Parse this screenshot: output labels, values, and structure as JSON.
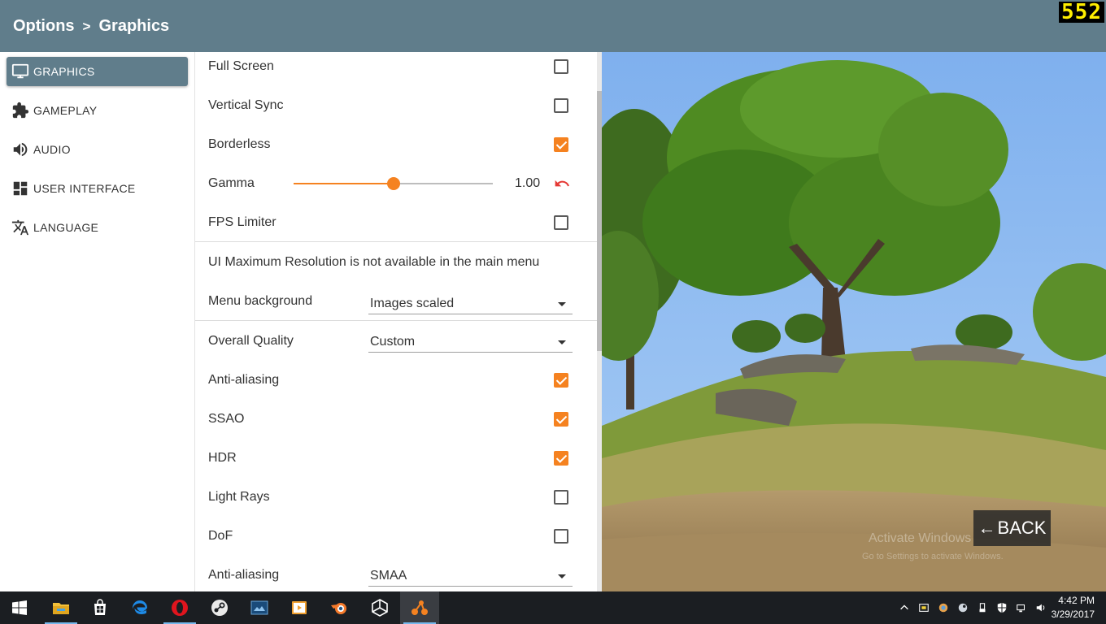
{
  "header": {
    "breadcrumb_root": "Options",
    "breadcrumb_sep": ">",
    "breadcrumb_current": "Graphics",
    "fps_counter": "552"
  },
  "sidebar": {
    "items": [
      {
        "label": "GRAPHICS",
        "icon": "monitor-icon",
        "active": true
      },
      {
        "label": "GAMEPLAY",
        "icon": "puzzle-icon",
        "active": false
      },
      {
        "label": "AUDIO",
        "icon": "speaker-icon",
        "active": false
      },
      {
        "label": "USER INTERFACE",
        "icon": "dashboard-icon",
        "active": false
      },
      {
        "label": "LANGUAGE",
        "icon": "translate-icon",
        "active": false
      }
    ]
  },
  "options": {
    "full_screen": {
      "label": "Full Screen",
      "checked": false
    },
    "vertical_sync": {
      "label": "Vertical Sync",
      "checked": false
    },
    "borderless": {
      "label": "Borderless",
      "checked": true
    },
    "gamma": {
      "label": "Gamma",
      "value": "1.00",
      "fraction": 0.5
    },
    "fps_limiter": {
      "label": "FPS Limiter",
      "checked": false
    },
    "ui_max_res_note": "UI Maximum Resolution is not available in the main menu",
    "menu_background": {
      "label": "Menu background",
      "value": "Images scaled"
    },
    "overall_quality": {
      "label": "Overall Quality",
      "value": "Custom"
    },
    "anti_aliasing_toggle": {
      "label": "Anti-aliasing",
      "checked": true
    },
    "ssao": {
      "label": "SSAO",
      "checked": true
    },
    "hdr": {
      "label": "HDR",
      "checked": true
    },
    "light_rays": {
      "label": "Light Rays",
      "checked": false
    },
    "dof": {
      "label": "DoF",
      "checked": false
    },
    "anti_aliasing_mode": {
      "label": "Anti-aliasing",
      "value": "SMAA"
    }
  },
  "gameview": {
    "back_label": "BACK",
    "back_arrow": "←",
    "watermark_line1": "Activate Windows",
    "watermark_line2": "Go to Settings to activate Windows."
  },
  "taskbar": {
    "apps": [
      "windows-start-icon",
      "file-explorer-icon",
      "store-icon",
      "edge-icon",
      "opera-icon",
      "steam-icon",
      "photo-app-icon",
      "media-player-icon",
      "blender-icon",
      "unity-icon",
      "beamng-icon"
    ],
    "clock_time": "4:42 PM",
    "clock_date": "3/29/2017"
  },
  "colors": {
    "accent": "#f58220",
    "header": "#607d8b",
    "taskbar": "#1b1e22"
  }
}
